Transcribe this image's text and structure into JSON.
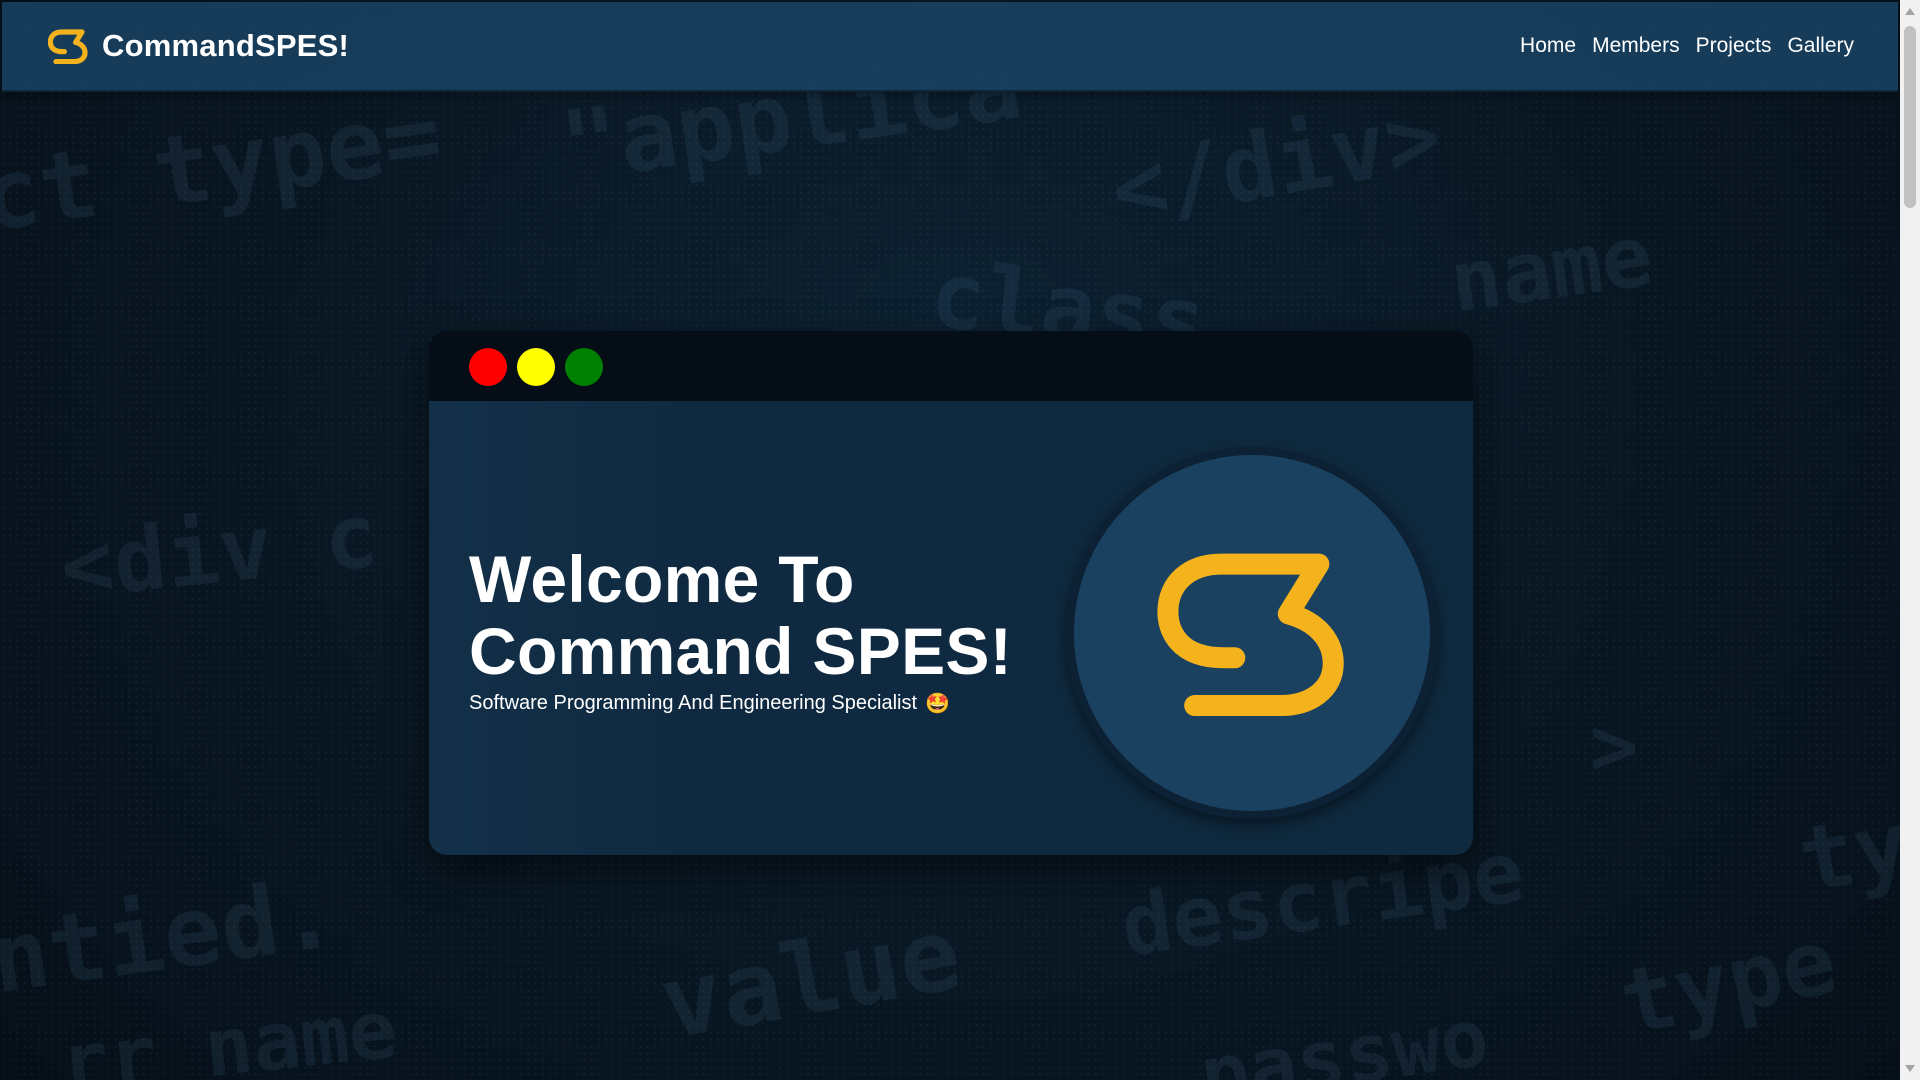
{
  "navbar": {
    "brand_name": "CommandSPES!",
    "brand_icon": "s-logo-icon",
    "links": [
      {
        "label": "Home"
      },
      {
        "label": "Members"
      },
      {
        "label": "Projects"
      },
      {
        "label": "Gallery"
      }
    ]
  },
  "background": {
    "code_snippets": [
      "ct type=",
      "\"applica",
      "</div>",
      "class",
      "<div c",
      "ntied.",
      "value",
      "rr name",
      "descripe",
      "type",
      "name",
      "passwo",
      ">",
      "ty"
    ]
  },
  "hero": {
    "title_line1": "Welcome To",
    "title_line2": "Command SPES!",
    "subtitle": "Software Programming And Engineering Specialist",
    "subtitle_emoji": "🤩",
    "window_dots": [
      {
        "name": "close",
        "color": "#ff0000"
      },
      {
        "name": "minimize",
        "color": "#ffff00"
      },
      {
        "name": "maximize",
        "color": "#008000"
      }
    ],
    "logo_icon": "s-logo-icon"
  },
  "colors": {
    "accent": "#f4b31c",
    "navbar": "#184060",
    "window_body": "#0f2a3f",
    "logo_circle": "#1a4160"
  }
}
